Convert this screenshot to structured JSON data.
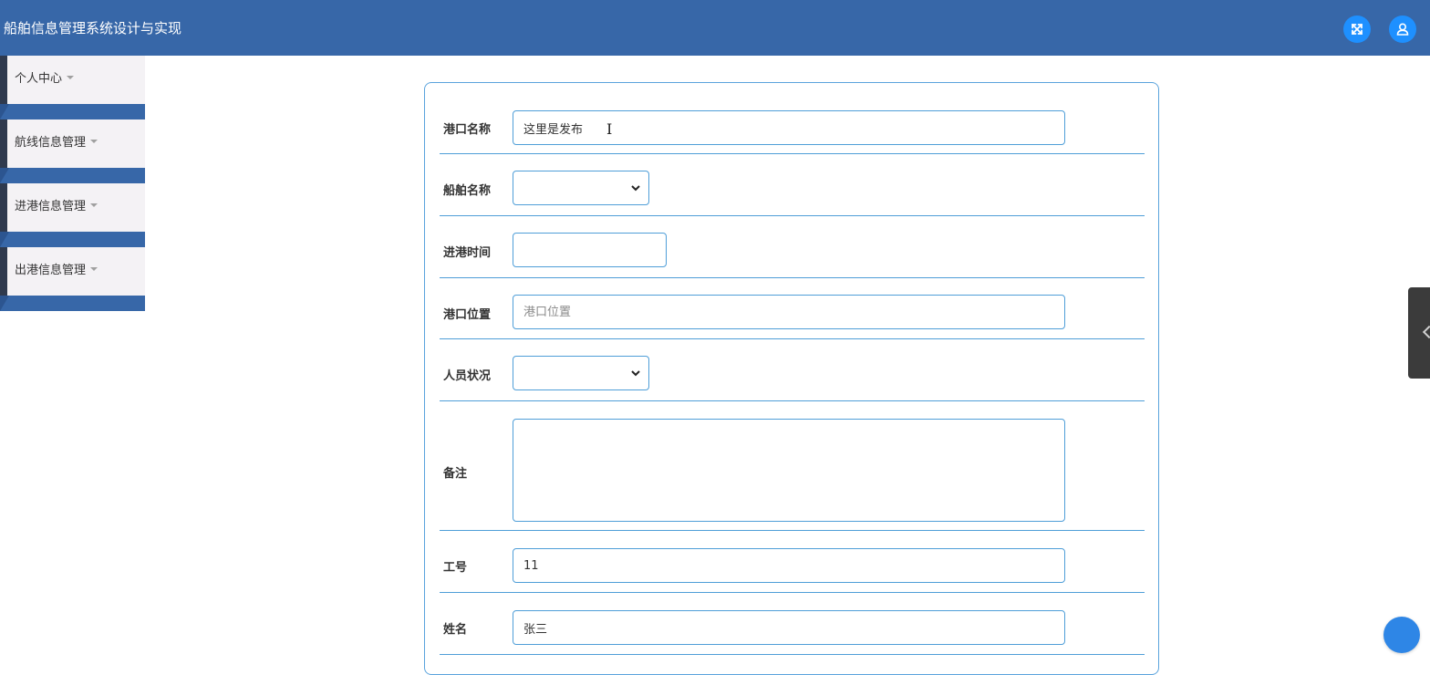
{
  "header": {
    "title": "船舶信息管理系统设计与实现",
    "fullscreen_icon": "expand-arrows-icon",
    "user_icon": "user-icon"
  },
  "sidebar": {
    "items": [
      {
        "label": "个人中心"
      },
      {
        "label": "航线信息管理"
      },
      {
        "label": "进港信息管理"
      },
      {
        "label": "出港信息管理"
      }
    ]
  },
  "form": {
    "port_name": {
      "label": "港口名称",
      "value": "这里是发布"
    },
    "ship_name": {
      "label": "船舶名称",
      "value": ""
    },
    "arrival_time": {
      "label": "进港时间",
      "value": ""
    },
    "port_location": {
      "label": "港口位置",
      "placeholder": "港口位置",
      "value": ""
    },
    "crew_status": {
      "label": "人员状况",
      "value": ""
    },
    "remark": {
      "label": "备注",
      "value": ""
    },
    "employee_no": {
      "label": "工号",
      "value": "11"
    },
    "name": {
      "label": "姓名",
      "value": "张三"
    }
  },
  "colors": {
    "header": "#3767a8",
    "accent": "#1e90ff",
    "border": "#4f9ed8"
  }
}
